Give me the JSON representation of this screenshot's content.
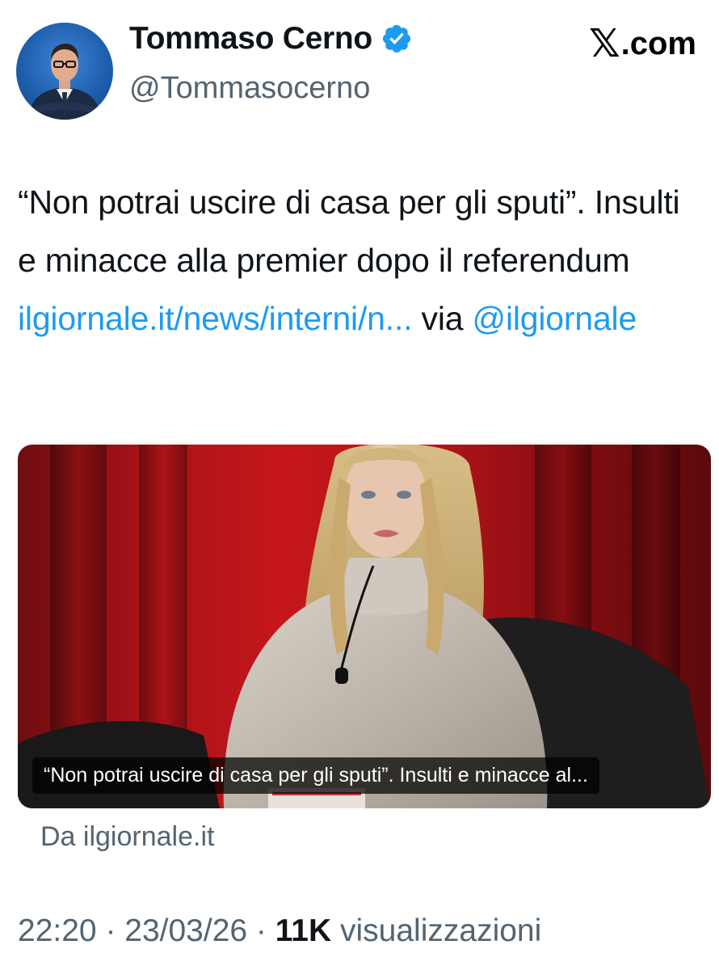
{
  "header": {
    "display_name": "Tommaso Cerno",
    "handle": "@Tommasocerno",
    "brand_glyph": "𝕏",
    "brand_suffix": ".com",
    "verified_color": "#1d9bf0"
  },
  "tweet": {
    "text_before": "“Non potrai uscire di casa per gli sputi”. Insulti e minacce alla premier dopo il referendum ",
    "link_text": "ilgiornale.it/news/interni/n...",
    "via_text": " via ",
    "mention": "@ilgiornale",
    "link_color": "#1d9bf0"
  },
  "card": {
    "caption": "“Non potrai uscire di casa per gli sputi”. Insulti e minacce al...",
    "source": "Da ilgiornale.it"
  },
  "meta": {
    "time": "22:20",
    "separator": " · ",
    "date": "23/03/26",
    "views_count": "11K",
    "views_label": " visualizzazioni"
  }
}
